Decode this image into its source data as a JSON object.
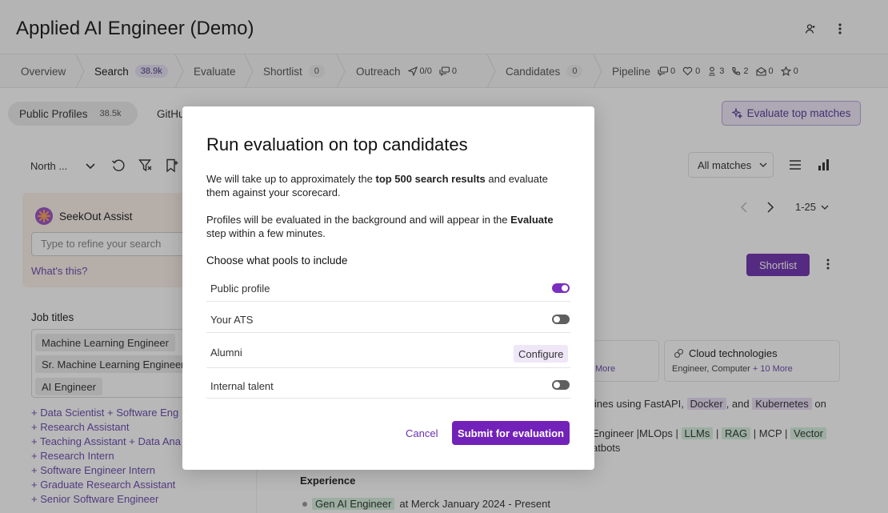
{
  "header": {
    "title": "Applied AI Engineer (Demo)"
  },
  "steps": {
    "overview": "Overview",
    "search": "Search",
    "search_count": "38.9k",
    "evaluate": "Evaluate",
    "shortlist": "Shortlist",
    "shortlist_count": "0",
    "outreach": "Outreach",
    "outreach_sent": "0/0",
    "outreach_replies": "0",
    "candidates": "Candidates",
    "candidates_count": "0",
    "pipeline": "Pipeline",
    "pipeline_msgs": "0",
    "pipeline_interested": "0",
    "pipeline_hired": "3",
    "pipeline_calls": "2",
    "pipeline_mail": "0",
    "pipeline_star": "0"
  },
  "subtabs": {
    "public_profiles": "Public Profiles",
    "public_count": "38.5k",
    "github": "GitHu"
  },
  "evaluate_top": "Evaluate top matches",
  "sidebar": {
    "location": "North ...",
    "assist_title": "SeekOut Assist",
    "assist_placeholder": "Type to refine your search",
    "whats_this": "What's this?",
    "job_titles_label": "Job titles",
    "job_titles": [
      "Machine Learning Engineer",
      "Sr. Machine Learning Engineer",
      "AI Engineer"
    ],
    "suggestions": [
      "+ Data Scientist + Software Eng",
      "+ Research Assistant",
      "+ Teaching Assistant + Data Ana",
      "+ Research Intern",
      "+ Software Engineer Intern",
      "+ Graduate Research Assistant",
      "+ Senior Software Engineer"
    ]
  },
  "results": {
    "all_matches": "All matches",
    "pager": "1-25",
    "shortlist": "Shortlist",
    "card_more": "More",
    "card_title": "Cloud technologies",
    "card_sub": "Engineer, Computer",
    "card_sub_more": "+ 10 More",
    "line1_pre": "lines using FastAPI,",
    "line1_docker": "Docker",
    "line1_mid": ", and",
    "line1_k8s": "Kubernetes",
    "line1_post": "on",
    "line2_pre": "Engineer |MLOps |",
    "line2_llms": "LLMs",
    "line2_sep": "|",
    "line2_rag": "RAG",
    "line2_mcp": "| MCP |",
    "line2_vector": "Vector",
    "line3": "atbots",
    "experience": "Experience",
    "exp_role": "Gen AI Engineer",
    "exp_rest": "at Merck January 2024 - Present"
  },
  "modal": {
    "title": "Run evaluation on top candidates",
    "p1_a": "We will take up to approximately the ",
    "p1_b": "top 500 search results",
    "p1_c": " and evaluate them against your scorecard.",
    "p2_a": "Profiles will be evaluated in the background and will appear in the ",
    "p2_b": "Evaluate",
    "p2_c": " step within a few minutes.",
    "pools_label": "Choose what pools to include",
    "pools": [
      {
        "name": "Public profile",
        "state": "on"
      },
      {
        "name": "Your ATS",
        "state": "off"
      },
      {
        "name": "Alumni",
        "action": "Configure"
      },
      {
        "name": "Internal talent",
        "state": "off"
      }
    ],
    "cancel": "Cancel",
    "submit": "Submit for evaluation"
  },
  "colors": {
    "accent": "#7222b8",
    "toggle_on": "#7a2fc0",
    "toggle_off": "#5f5f5f",
    "link": "#6b2fb0"
  },
  "icons": [
    "user-icon",
    "more-vertical-icon",
    "send-icon",
    "chat-icon",
    "heart-icon",
    "hired-icon",
    "phone-icon",
    "mail-icon",
    "star-icon",
    "sparkle-icon",
    "refresh-icon",
    "filter-icon",
    "bookmark-icon",
    "list-icon",
    "chart-icon",
    "cloud-icon"
  ]
}
